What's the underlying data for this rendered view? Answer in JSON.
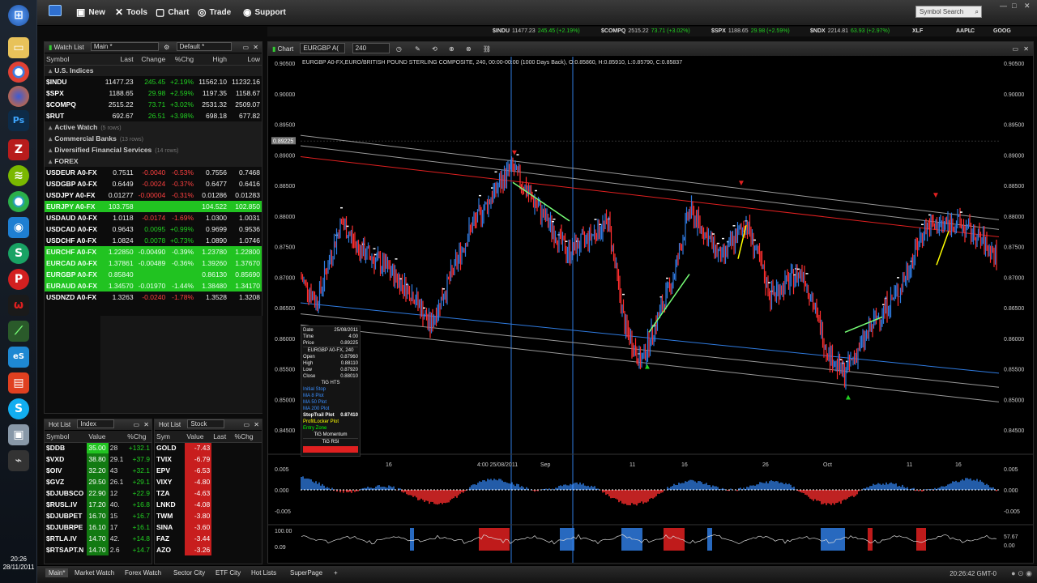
{
  "taskbar": {
    "icons": [
      "windows-icon",
      "folder-icon",
      "chrome-icon",
      "firefox-icon",
      "photoshop-icon",
      "filezilla-icon",
      "spotify-icon",
      "chrome-canary-icon",
      "crossloop-icon",
      "skype-s-icon",
      "pinterest-icon",
      "opera-icon",
      "chart-app-icon",
      "esignal-icon",
      "slides-icon",
      "skype-icon",
      "monitor-icon",
      "usb-icon"
    ],
    "time": "20:26",
    "date": "28/11/2011"
  },
  "toolbar": {
    "new_label": "New",
    "tools_label": "Tools",
    "chart_label": "Chart",
    "trade_label": "Trade",
    "support_label": "Support",
    "search_placeholder": "Symbol Search"
  },
  "ticker": [
    {
      "sym": "$INDU",
      "price": "11477.23",
      "chg": "245.45 (+2.19%)"
    },
    {
      "sym": "$COMPQ",
      "price": "2515.22",
      "chg": "73.71 (+3.02%)"
    },
    {
      "sym": "$SPX",
      "price": "1188.65",
      "chg": "29.98 (+2.59%)"
    },
    {
      "sym": "$NDX",
      "price": "2214.81",
      "chg": "63.93 (+2.97%)"
    },
    {
      "sym": "XLF",
      "price": "",
      "chg": ""
    },
    {
      "sym": "AAPL",
      "price": "",
      "chg": ""
    },
    {
      "sym": "C",
      "price": "",
      "chg": ""
    },
    {
      "sym": "GOOG",
      "price": "",
      "chg": ""
    }
  ],
  "watchlist": {
    "title": "Watch List",
    "list_select": "Main *",
    "layout_select": "Default *",
    "columns": [
      "Symbol",
      "Last",
      "Change",
      "%Chg",
      "High",
      "Low"
    ],
    "groups": [
      {
        "label": "U.S. Indices",
        "count": "",
        "rows": [
          [
            "$INDU",
            "11477.23",
            "245.45",
            "+2.19%",
            "11562.10",
            "11232.16",
            "pos",
            ""
          ],
          [
            "$SPX",
            "1188.65",
            "29.98",
            "+2.59%",
            "1197.35",
            "1158.67",
            "pos",
            ""
          ],
          [
            "$COMPQ",
            "2515.22",
            "73.71",
            "+3.02%",
            "2531.32",
            "2509.07",
            "pos",
            ""
          ],
          [
            "$RUT",
            "692.67",
            "26.51",
            "+3.98%",
            "698.18",
            "677.82",
            "pos",
            ""
          ]
        ]
      },
      {
        "label": "Active Watch",
        "count": "(5 rows)",
        "rows": []
      },
      {
        "label": "Commercial Banks",
        "count": "(13 rows)",
        "rows": []
      },
      {
        "label": "Diversified Financial Services",
        "count": "(14 rows)",
        "rows": []
      },
      {
        "label": "FOREX",
        "count": "",
        "rows": [
          [
            "USDEUR A0-FX",
            "0.7511",
            "-0.0040",
            "-0.53%",
            "0.7556",
            "0.7468",
            "neg",
            ""
          ],
          [
            "USDGBP A0-FX",
            "0.6449",
            "-0.0024",
            "-0.37%",
            "0.6477",
            "0.6416",
            "neg",
            ""
          ],
          [
            "USDJPY A0-FX",
            "0.01277",
            "-0.00004",
            "-0.31%",
            "0.01286",
            "0.01283",
            "neg",
            ""
          ],
          [
            "EURJPY A0-FX",
            "103.758",
            "",
            "",
            "104.522",
            "102.850",
            "pos",
            "hl"
          ],
          [
            "USDAUD A0-FX",
            "1.0118",
            "-0.0174",
            "-1.69%",
            "1.0300",
            "1.0031",
            "neg",
            ""
          ],
          [
            "USDCAD A0-FX",
            "0.9643",
            "0.0095",
            "+0.99%",
            "0.9699",
            "0.9536",
            "pos",
            ""
          ],
          [
            "USDCHF A0-FX",
            "1.0824",
            "0.0078",
            "+0.73%",
            "1.0890",
            "1.0746",
            "pos",
            ""
          ],
          [
            "EURCHF A0-FX",
            "1.22850",
            "-0.00490",
            "-0.39%",
            "1.23780",
            "1.22800",
            "neg",
            "hl"
          ],
          [
            "EURCAD A0-FX",
            "1.37861",
            "-0.00489",
            "-0.36%",
            "1.39260",
            "1.37670",
            "neg",
            "hl"
          ],
          [
            "EURGBP A0-FX",
            "0.85840",
            "",
            "",
            "0.86130",
            "0.85690",
            "pos",
            "hl"
          ],
          [
            "EURAUD A0-FX",
            "1.34570",
            "-0.01970",
            "-1.44%",
            "1.38480",
            "1.34170",
            "neg",
            "hl"
          ],
          [
            "USDNZD A0-FX",
            "1.3263",
            "-0.0240",
            "-1.78%",
            "1.3528",
            "1.3208",
            "neg",
            ""
          ]
        ]
      }
    ]
  },
  "hotlist_index": {
    "title": "Hot List",
    "select": "Index",
    "columns": [
      "Symbol",
      "Value",
      "%Chg"
    ],
    "rows": [
      [
        "$DDB",
        "35.00",
        "28",
        "+132.1"
      ],
      [
        "$VXD",
        "38.80",
        "29.1",
        "+37.9"
      ],
      [
        "$OIV",
        "32.20",
        "43",
        "+32.1"
      ],
      [
        "$GVZ",
        "29.50",
        "26.1",
        "+29.1"
      ],
      [
        "$DJUBSCO",
        "22.90",
        "12",
        "+22.9"
      ],
      [
        "$RUSL.IV",
        "17.20",
        "40.",
        "+16.8"
      ],
      [
        "$DJUBPET",
        "16.70",
        "15",
        "+16.7"
      ],
      [
        "$DJUBRPE",
        "16.10",
        "17",
        "+16.1"
      ],
      [
        "$RTLA.IV",
        "14.70",
        "42.",
        "+14.8"
      ],
      [
        "$RTSAPT.N",
        "14.70",
        "2.6",
        "+14.7"
      ]
    ]
  },
  "hotlist_stock": {
    "title": "Hot List",
    "select": "Stock",
    "columns": [
      "Sym",
      "Value",
      "Last",
      "%Chg"
    ],
    "rows": [
      [
        "GOLD",
        "-7.43"
      ],
      [
        "TVIX",
        "-6.79"
      ],
      [
        "EPV",
        "-6.53"
      ],
      [
        "VIXY",
        "-4.80"
      ],
      [
        "TZA",
        "-4.63"
      ],
      [
        "LNKD",
        "-4.08"
      ],
      [
        "TWM",
        "-3.80"
      ],
      [
        "SINA",
        "-3.60"
      ],
      [
        "FAZ",
        "-3.44"
      ],
      [
        "AZO",
        "-3.26"
      ]
    ]
  },
  "chart": {
    "tab_label": "Chart",
    "symbol": "EURGBP A(",
    "interval": "240",
    "info_line": "EURGBP A0-FX,EURO/BRITISH POUND STERLING COMPOSITE, 240, 00:00-00:00 (1000 Days Back), O:0.85860, H:0.85910, L:0.85790, C:0.85837",
    "price_ticks": [
      "0.90500",
      "0.90000",
      "0.89500",
      "0.89000",
      "0.88500",
      "0.88000",
      "0.87500",
      "0.87000",
      "0.86500",
      "0.86000",
      "0.85500",
      "0.85000",
      "0.84500"
    ],
    "highlight_price": "0.89225",
    "date_ticks": [
      "16",
      "4:00 25/08/2011",
      "Sep",
      "11",
      "16",
      "26",
      "Oct",
      "11",
      "16"
    ],
    "osc_ticks": [
      "0.005",
      "0.000",
      "-0.005"
    ],
    "rsi_ticks": [
      "100.00",
      "0.09"
    ],
    "rsi_values": [
      "57.67",
      "0.00"
    ],
    "data_box": {
      "rows": [
        [
          "Date",
          "25/08/2011"
        ],
        [
          "Time",
          "4:00"
        ],
        [
          "Price",
          "0.89225"
        ]
      ],
      "symbol": "EURGBP A0-FX, 240",
      "ohlc": [
        [
          "Open",
          "0.87960"
        ],
        [
          "High",
          "0.88110"
        ],
        [
          "Low",
          "0.87920"
        ],
        [
          "Close",
          "0.88010"
        ]
      ],
      "study1": "TiG HTS",
      "plots": [
        "Initial Stop",
        "MA 8 Plot",
        "MA 50 Plot",
        "MA 200 Plot"
      ],
      "stoptrail": [
        "StopTrail Plot",
        "0.87410"
      ],
      "profitlocker": "ProfitLocker Plot",
      "entryzone": "Entry Zone",
      "study2": "TiG Momentum",
      "study3": "TiG RSI"
    }
  },
  "bottom_tabs": [
    "Main*",
    "Market Watch",
    "Forex Watch",
    "Sector City",
    "ETF City",
    "Hot Lists",
    "SuperPage",
    "+"
  ],
  "clock": "20:26:42 GMT-0",
  "colors": {
    "up": "#2f7be0",
    "down": "#ff2e2e",
    "accent_green": "#21c321"
  }
}
